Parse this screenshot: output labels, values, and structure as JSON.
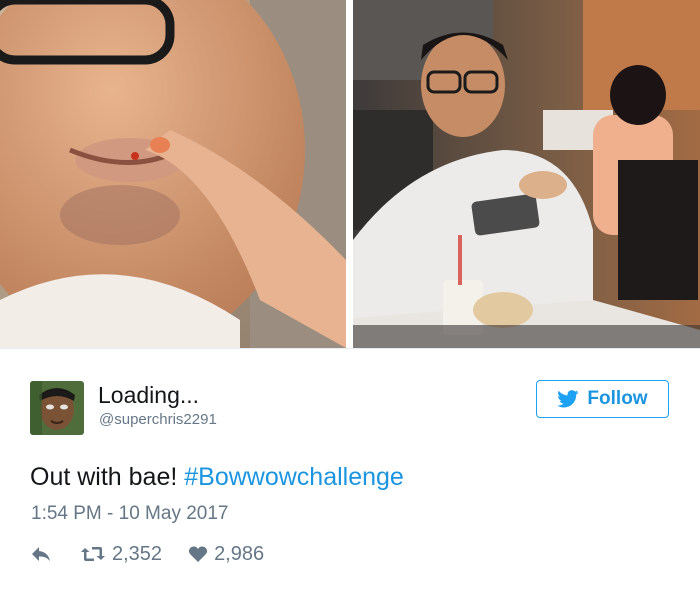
{
  "photos": {
    "left_alt": "",
    "right_alt": ""
  },
  "tweet": {
    "display_name": "Loading...",
    "handle": "@superchris2291",
    "follow_label": "Follow",
    "text_plain": "Out with bae! ",
    "hashtag": "#Bowwowchallenge",
    "timestamp": "1:54 PM - 10 May 2017",
    "retweets": "2,352",
    "likes": "2,986"
  },
  "icons": {
    "reply": "reply-icon",
    "retweet": "retweet-icon",
    "like": "heart-icon",
    "follow": "twitter-bird-icon"
  },
  "colors": {
    "accent": "#1b95e0",
    "muted": "#657786",
    "text": "#14171a"
  }
}
